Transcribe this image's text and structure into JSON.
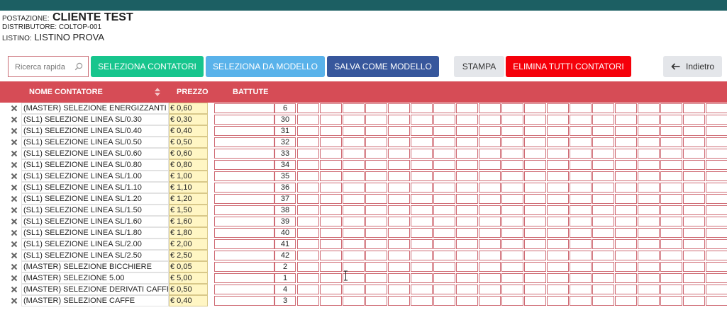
{
  "header": {
    "postazione_label": "POSTAZIONE:",
    "postazione_value": "CLIENTE TEST",
    "distributore_label": "DISTRIBUTORE:",
    "distributore_value": "COLTOP-001",
    "listino_label": "LISTINO:",
    "listino_value": "LISTINO PROVA"
  },
  "toolbar": {
    "search_placeholder": "Ricerca rapida",
    "seleziona_contatori": "SELEZIONA CONTATORI",
    "seleziona_da_modello": "SELEZIONA DA MODELLO",
    "salva_come_modello": "SALVA COME MODELLO",
    "stampa": "STAMPA",
    "elimina_tutti": "ELIMINA TUTTI CONTATORI",
    "indietro": "Indietro"
  },
  "colors": {
    "topbar": "#1c5f63",
    "header_red": "#d64c56",
    "green": "#17c58d",
    "light_blue": "#59b2ea",
    "navy": "#37579c",
    "red": "#f5000a",
    "price_bg": "#fff6c4"
  },
  "icons": {
    "search": "search-icon",
    "back": "arrow-left-icon",
    "sort": "sort-icon",
    "delete": "close-icon"
  },
  "table": {
    "columns": {
      "name": "NOME CONTATORE",
      "price": "PREZZO",
      "battute": "BATTUTE"
    },
    "rows": [
      {
        "name": "(MASTER) SELEZIONE ENERGIZZANTI",
        "price": "€ 0,60",
        "battute": "6"
      },
      {
        "name": "(SL1) SELEZIONE LINEA SL/0.30",
        "price": "€ 0,30",
        "battute": "30"
      },
      {
        "name": "(SL1) SELEZIONE LINEA SL/0.40",
        "price": "€ 0,40",
        "battute": "31"
      },
      {
        "name": "(SL1) SELEZIONE LINEA SL/0.50",
        "price": "€ 0,50",
        "battute": "32"
      },
      {
        "name": "(SL1) SELEZIONE LINEA SL/0.60",
        "price": "€ 0,60",
        "battute": "33"
      },
      {
        "name": "(SL1) SELEZIONE LINEA SL/0.80",
        "price": "€ 0,80",
        "battute": "34"
      },
      {
        "name": "(SL1) SELEZIONE LINEA SL/1.00",
        "price": "€ 1,00",
        "battute": "35"
      },
      {
        "name": "(SL1) SELEZIONE LINEA SL/1.10",
        "price": "€ 1,10",
        "battute": "36"
      },
      {
        "name": "(SL1) SELEZIONE LINEA SL/1.20",
        "price": "€ 1,20",
        "battute": "37"
      },
      {
        "name": "(SL1) SELEZIONE LINEA SL/1.50",
        "price": "€ 1,50",
        "battute": "38"
      },
      {
        "name": "(SL1) SELEZIONE LINEA SL/1.60",
        "price": "€ 1,60",
        "battute": "39"
      },
      {
        "name": "(SL1) SELEZIONE LINEA SL/1.80",
        "price": "€ 1,80",
        "battute": "40"
      },
      {
        "name": "(SL1) SELEZIONE LINEA SL/2.00",
        "price": "€ 2,00",
        "battute": "41"
      },
      {
        "name": "(SL1) SELEZIONE LINEA SL/2.50",
        "price": "€ 2,50",
        "battute": "42"
      },
      {
        "name": "(MASTER) SELEZIONE BICCHIERE",
        "price": "€ 0,05",
        "battute": "2"
      },
      {
        "name": "(MASTER) SELEZIONE 5.00",
        "price": "€ 5,00",
        "battute": "1"
      },
      {
        "name": "(MASTER) SELEZIONE DERIVATI CAFFE",
        "price": "€ 0,50",
        "battute": "4"
      },
      {
        "name": "(MASTER) SELEZIONE CAFFE",
        "price": "€ 0,40",
        "battute": "3"
      }
    ]
  }
}
